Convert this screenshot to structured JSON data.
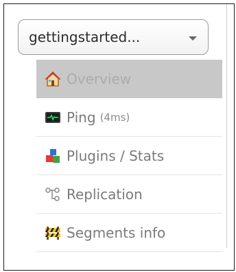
{
  "core_selector": {
    "selected": "gettingstarted..."
  },
  "menu": {
    "items": [
      {
        "label": "Overview",
        "icon": "home-icon",
        "active": true
      },
      {
        "label": "Ping",
        "suffix": "(4ms)",
        "icon": "monitor-icon"
      },
      {
        "label": "Plugins / Stats",
        "icon": "plugins-icon"
      },
      {
        "label": "Replication",
        "icon": "replication-icon"
      },
      {
        "label": "Segments info",
        "icon": "barrier-icon"
      }
    ]
  }
}
